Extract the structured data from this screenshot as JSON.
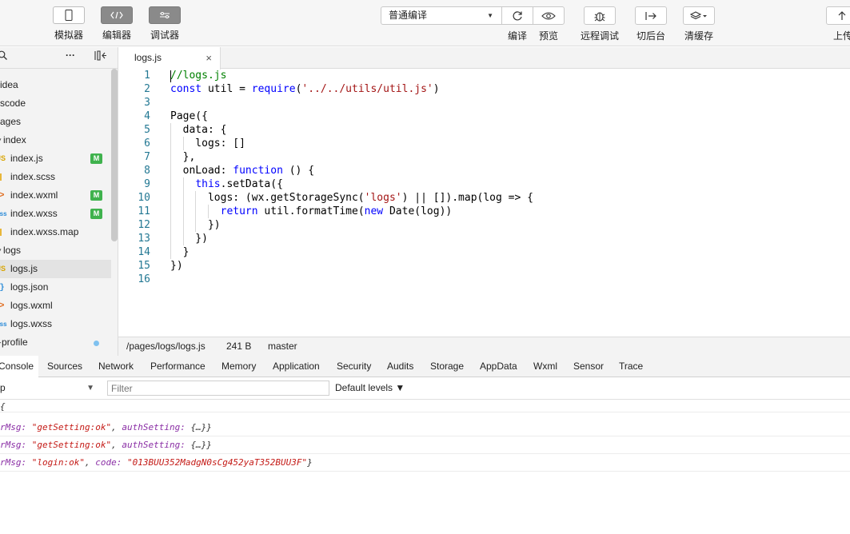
{
  "toolbar": {
    "simulator_label": "模拟器",
    "editor_label": "编辑器",
    "debugger_label": "调试器",
    "compile_mode": "普通编译",
    "compile_label": "编译",
    "preview_label": "预览",
    "remote_debug_label": "远程调试",
    "background_label": "切后台",
    "clear_cache_label": "清缓存",
    "upload_label": "上传"
  },
  "sidebar": {
    "more": "···",
    "items": [
      {
        "label": "idea",
        "icon": ""
      },
      {
        "label": "scode",
        "icon": ""
      },
      {
        "label": "ages",
        "icon": ""
      },
      {
        "label": "index",
        "icon": ""
      },
      {
        "label": "index.js",
        "icon": "JS",
        "badge": "M"
      },
      {
        "label": "index.scss",
        "icon": ""
      },
      {
        "label": "index.wxml",
        "icon": ">",
        "badge": "M"
      },
      {
        "label": "index.wxss",
        "icon": "wxss",
        "badge": "M"
      },
      {
        "label": "index.wxss.map",
        "icon": ""
      },
      {
        "label": "logs",
        "icon": ""
      },
      {
        "label": "logs.js",
        "icon": "JS"
      },
      {
        "label": "logs.json",
        "icon": "{}"
      },
      {
        "label": "logs.wxml",
        "icon": ">"
      },
      {
        "label": "logs.wxss",
        "icon": "wxss"
      },
      {
        "label": "profile",
        "icon": ""
      }
    ]
  },
  "editor": {
    "tab_name": "logs.js",
    "close_glyph": "×",
    "lines": [
      {
        "n": "1",
        "segs": [
          {
            "t": "//logs.js",
            "c": "cm"
          }
        ]
      },
      {
        "n": "2",
        "segs": [
          {
            "t": "const",
            "c": "kw"
          },
          {
            "t": " util = "
          },
          {
            "t": "require",
            "c": "kw"
          },
          {
            "t": "("
          },
          {
            "t": "'../../utils/util.js'",
            "c": "str"
          },
          {
            "t": ")"
          }
        ]
      },
      {
        "n": "3",
        "segs": []
      },
      {
        "n": "4",
        "segs": [
          {
            "t": "Page({"
          }
        ]
      },
      {
        "n": "5",
        "segs": [
          {
            "t": "  data: {"
          }
        ]
      },
      {
        "n": "6",
        "segs": [
          {
            "t": "    logs: []"
          }
        ]
      },
      {
        "n": "7",
        "segs": [
          {
            "t": "  },"
          }
        ]
      },
      {
        "n": "8",
        "segs": [
          {
            "t": "  onLoad: "
          },
          {
            "t": "function",
            "c": "kw"
          },
          {
            "t": " () {"
          }
        ]
      },
      {
        "n": "9",
        "segs": [
          {
            "t": "    "
          },
          {
            "t": "this",
            "c": "kw"
          },
          {
            "t": ".setData({"
          }
        ]
      },
      {
        "n": "10",
        "segs": [
          {
            "t": "      logs: (wx.getStorageSync("
          },
          {
            "t": "'logs'",
            "c": "str"
          },
          {
            "t": ") || []).map(log => {"
          }
        ]
      },
      {
        "n": "11",
        "segs": [
          {
            "t": "        "
          },
          {
            "t": "return",
            "c": "kw"
          },
          {
            "t": " util.formatTime("
          },
          {
            "t": "new",
            "c": "kw"
          },
          {
            "t": " Date(log))"
          }
        ]
      },
      {
        "n": "12",
        "segs": [
          {
            "t": "      })"
          }
        ]
      },
      {
        "n": "13",
        "segs": [
          {
            "t": "    })"
          }
        ]
      },
      {
        "n": "14",
        "segs": [
          {
            "t": "  }"
          }
        ]
      },
      {
        "n": "15",
        "segs": [
          {
            "t": "})"
          }
        ]
      },
      {
        "n": "16",
        "segs": []
      }
    ]
  },
  "status": {
    "path": "/pages/logs/logs.js",
    "size": "241 B",
    "branch": "master"
  },
  "devtools": {
    "tabs": [
      "Console",
      "Sources",
      "Network",
      "Performance",
      "Memory",
      "Application",
      "Security",
      "Audits",
      "Storage",
      "AppData",
      "Wxml",
      "Sensor",
      "Trace"
    ],
    "context": "p",
    "filter_placeholder": "Filter",
    "levels": "Default levels ▼",
    "logs": [
      {
        "segs": [
          {
            "t": "{"
          }
        ]
      },
      {
        "segs": [
          {
            "t": "rMsg: ",
            "c": "k"
          },
          {
            "t": "\"getSetting:ok\"",
            "c": "s"
          },
          {
            "t": ", "
          },
          {
            "t": "authSetting: ",
            "c": "k"
          },
          {
            "t": "{…}}"
          }
        ]
      },
      {
        "segs": [
          {
            "t": "rMsg: ",
            "c": "k"
          },
          {
            "t": "\"getSetting:ok\"",
            "c": "s"
          },
          {
            "t": ", "
          },
          {
            "t": "authSetting: ",
            "c": "k"
          },
          {
            "t": "{…}}"
          }
        ]
      },
      {
        "segs": [
          {
            "t": "rMsg: ",
            "c": "k"
          },
          {
            "t": "\"login:ok\"",
            "c": "s"
          },
          {
            "t": ", "
          },
          {
            "t": "code: ",
            "c": "k"
          },
          {
            "t": "\"013BUU352MadgN0sCg452yaT352BUU3F\"",
            "c": "s"
          },
          {
            "t": "}"
          }
        ]
      }
    ]
  },
  "colors": {
    "badge": "#3fb24d",
    "keyword": "#0000ff",
    "string": "#a31515",
    "comment": "#008000",
    "line_number": "#237893"
  }
}
